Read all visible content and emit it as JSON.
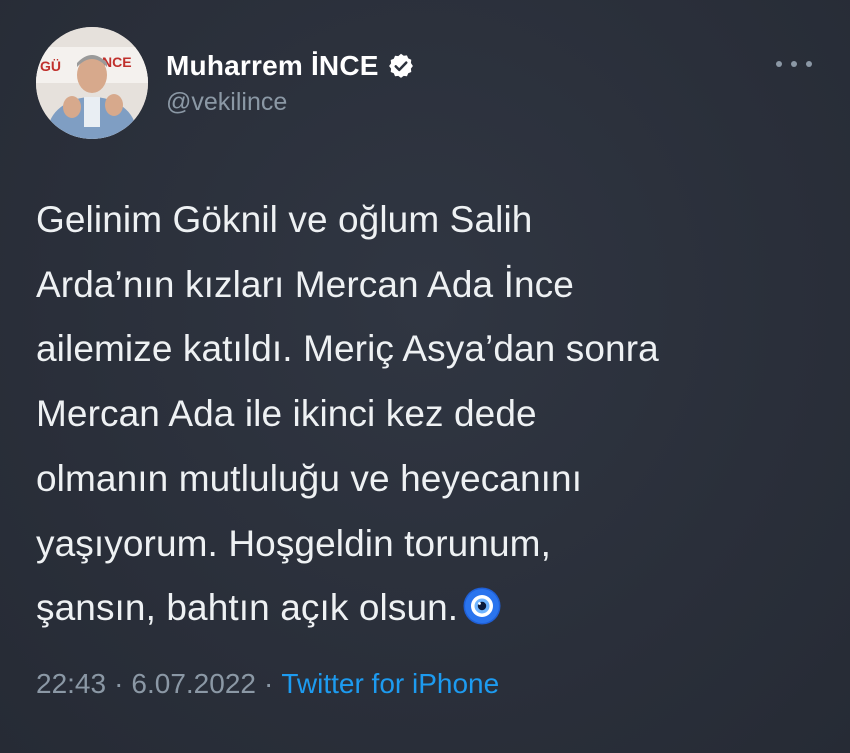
{
  "author": {
    "display_name": "Muharrem İNCE",
    "handle": "@vekilince",
    "verified": true,
    "avatar_banner_text": "GÜ  NCE"
  },
  "tweet": {
    "lines": [
      "Gelinim Göknil ve oğlum Salih",
      "Arda’nın kızları Mercan Ada İnce",
      "ailemize katıldı. Meriç Asya’dan sonra",
      "Mercan Ada ile ikinci kez dede",
      "olmanın mutluluğu ve heyecanını",
      "yaşıyorum. Hoşgeldin torunum,",
      "şansın, bahtın açık olsun."
    ],
    "trailing_icon": "nazar-evil-eye-icon"
  },
  "meta": {
    "time": "22:43",
    "date": "6.07.2022",
    "separator": "·",
    "source": "Twitter for iPhone"
  },
  "icons": {
    "verified": "verified-badge-icon",
    "more": "more-options-icon"
  },
  "colors": {
    "background": "#2b313c",
    "text": "#eef1f3",
    "secondary": "#8b98a5",
    "link": "#1d9bf0"
  }
}
